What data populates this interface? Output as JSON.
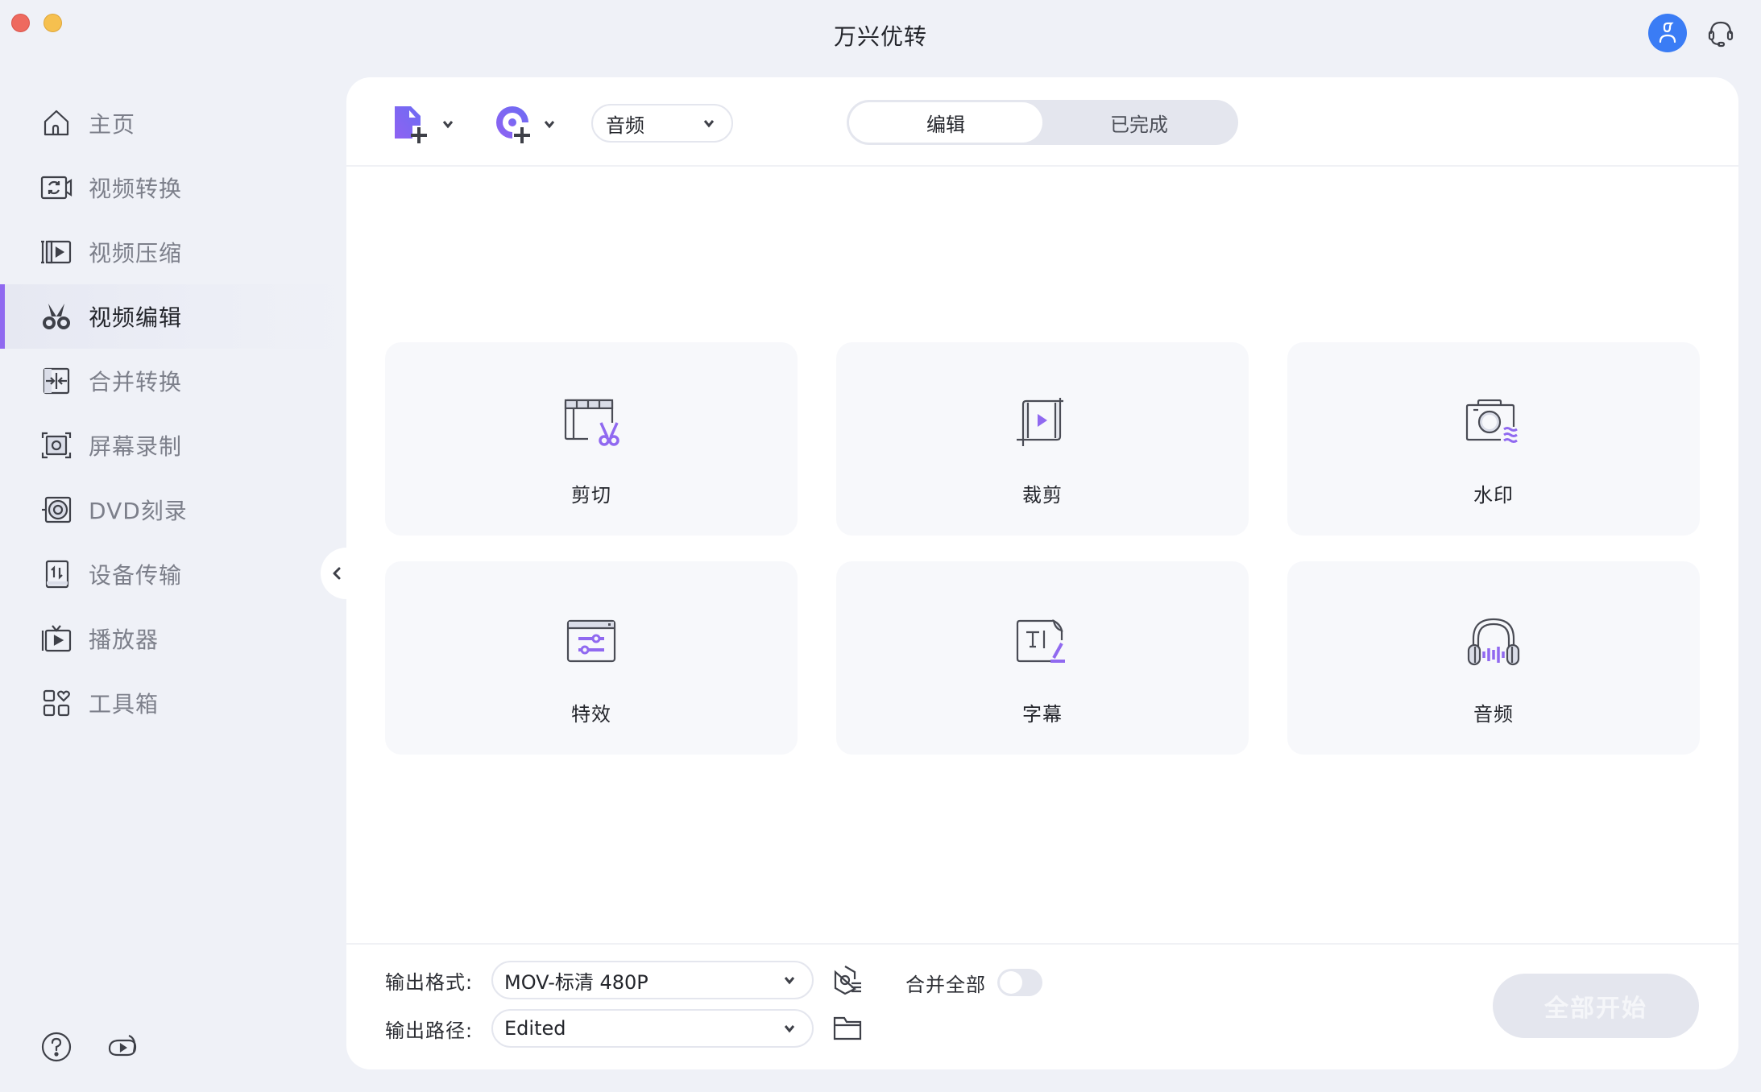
{
  "window": {
    "title": "万兴优转"
  },
  "header": {
    "account_icon": "user-icon",
    "support_icon": "headset-icon"
  },
  "sidebar": {
    "items": [
      {
        "label": "主页",
        "icon": "home-icon",
        "active": false
      },
      {
        "label": "视频转换",
        "icon": "video-convert-icon",
        "active": false
      },
      {
        "label": "视频压缩",
        "icon": "video-compress-icon",
        "active": false
      },
      {
        "label": "视频编辑",
        "icon": "scissors-icon",
        "active": true
      },
      {
        "label": "合并转换",
        "icon": "merge-icon",
        "active": false
      },
      {
        "label": "屏幕录制",
        "icon": "screen-record-icon",
        "active": false
      },
      {
        "label": "DVD刻录",
        "icon": "dvd-icon",
        "active": false
      },
      {
        "label": "设备传输",
        "icon": "device-transfer-icon",
        "active": false
      },
      {
        "label": "播放器",
        "icon": "player-icon",
        "active": false
      },
      {
        "label": "工具箱",
        "icon": "toolbox-icon",
        "active": false
      }
    ],
    "bottom_icons": [
      "help-icon",
      "tutorial-icon"
    ]
  },
  "toolbar": {
    "add_file_icon": "add-file-icon",
    "add_disc_icon": "add-disc-icon",
    "media_type": "音频",
    "tabs": [
      {
        "label": "编辑",
        "active": true
      },
      {
        "label": "已完成",
        "active": false
      }
    ]
  },
  "tools": [
    {
      "label": "剪切",
      "icon": "trim-icon"
    },
    {
      "label": "裁剪",
      "icon": "crop-icon"
    },
    {
      "label": "水印",
      "icon": "watermark-icon"
    },
    {
      "label": "特效",
      "icon": "effects-icon"
    },
    {
      "label": "字幕",
      "icon": "subtitle-icon"
    },
    {
      "label": "音频",
      "icon": "audio-icon"
    }
  ],
  "bottom": {
    "output_format_label": "输出格式:",
    "output_format_value": "MOV-标清 480P",
    "output_path_label": "输出路径:",
    "output_path_value": "Edited",
    "merge_all_label": "合并全部",
    "merge_all_enabled": false,
    "start_all_label": "全部开始"
  },
  "colors": {
    "accent": "#9069f0",
    "avatar": "#3a7cf5",
    "background": "#eff1f7"
  }
}
